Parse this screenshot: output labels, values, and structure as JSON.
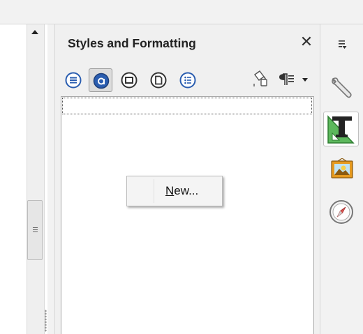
{
  "panel": {
    "title": "Styles and Formatting",
    "close_glyph": "✕"
  },
  "toolbar": {
    "style_families": [
      {
        "name": "paragraph-styles-icon",
        "active": false
      },
      {
        "name": "character-styles-icon",
        "active": true
      },
      {
        "name": "frame-styles-icon",
        "active": false
      },
      {
        "name": "page-styles-icon",
        "active": false
      },
      {
        "name": "list-styles-icon",
        "active": false
      }
    ],
    "fill_format_icon": "fill-format-mode-icon",
    "style_actions_icon": "paragraph-mark-icon"
  },
  "context_menu": {
    "items": [
      {
        "label_mnemonic": "N",
        "label_rest": "ew..."
      }
    ]
  },
  "sidebar": {
    "items": [
      {
        "name": "menu-icon",
        "active": false
      },
      {
        "name": "properties-wrench-icon",
        "active": false
      },
      {
        "name": "styles-and-formatting-icon",
        "active": true
      },
      {
        "name": "gallery-icon",
        "active": false
      },
      {
        "name": "navigator-compass-icon",
        "active": false
      }
    ]
  },
  "colors": {
    "icon_blue": "#2a5db0",
    "accent_green": "#4caf50",
    "gallery_orange": "#e69a1e"
  }
}
